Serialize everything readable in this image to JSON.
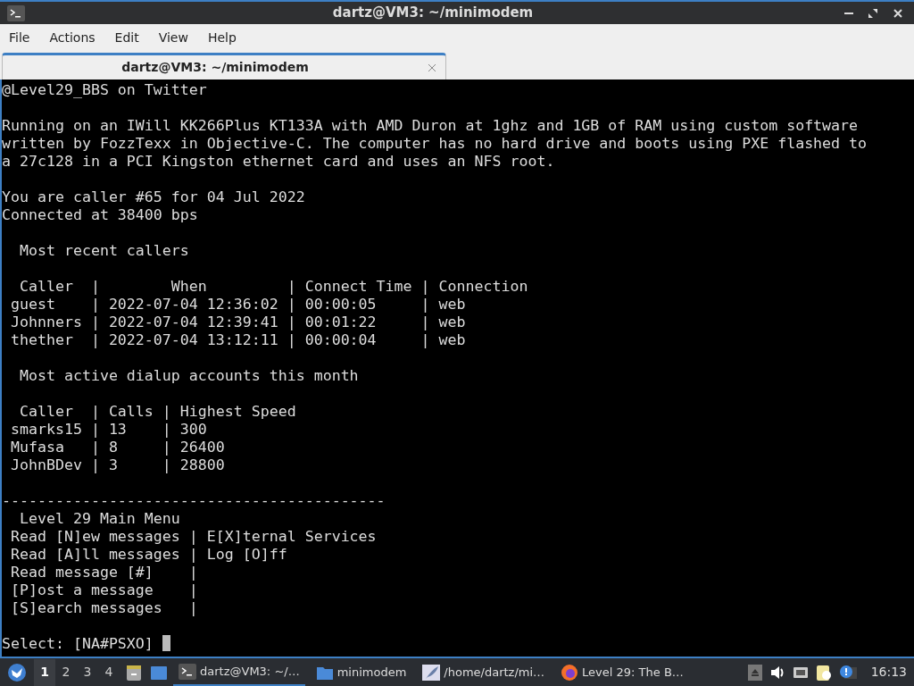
{
  "window": {
    "title": "dartz@VM3: ~/minimodem"
  },
  "menu": [
    "File",
    "Actions",
    "Edit",
    "View",
    "Help"
  ],
  "tabs": [
    {
      "label": "dartz@VM3: ~/minimodem",
      "selected": true
    }
  ],
  "terminal": {
    "blocks": [
      [
        "@Level29_BBS on Twitter"
      ],
      [
        "Running on an IWill KK266Plus KT133A with AMD Duron at 1ghz and 1GB of RAM using custom software",
        "written by FozzTexx in Objective-C. The computer has no hard drive and boots using PXE flashed to",
        "a 27c128 in a PCI Kingston ethernet card and uses an NFS root."
      ],
      [
        "You are caller #65 for 04 Jul 2022",
        "Connected at 38400 bps"
      ],
      [
        "  Most recent callers"
      ],
      [
        "  Caller  |        When         | Connect Time | Connection",
        " guest    | 2022-07-04 12:36:02 | 00:00:05     | web",
        " Johnners | 2022-07-04 12:39:41 | 00:01:22     | web",
        " thether  | 2022-07-04 13:12:11 | 00:00:04     | web"
      ],
      [
        "  Most active dialup accounts this month"
      ],
      [
        "  Caller  | Calls | Highest Speed",
        " smarks15 | 13    | 300",
        " Mufasa   | 8     | 26400",
        " JohnBDev | 3     | 28800"
      ],
      [
        "-------------------------------------------",
        "  Level 29 Main Menu",
        " Read [N]ew messages | E[X]ternal Services",
        " Read [A]ll messages | Log [O]ff",
        " Read message [#]    |",
        " [P]ost a message    |",
        " [S]earch messages   |"
      ]
    ],
    "prompt": "Select: [NA#PSXO]"
  },
  "taskbar": {
    "workspaces": [
      {
        "label": "1",
        "selected": true
      },
      {
        "label": "2",
        "selected": false
      },
      {
        "label": "3",
        "selected": false
      },
      {
        "label": "4",
        "selected": false
      }
    ],
    "tasks": [
      {
        "kind": "terminal",
        "label": "dartz@VM3: ~/…",
        "selected": true
      },
      {
        "kind": "folder",
        "label": "minimodem",
        "selected": false
      },
      {
        "kind": "editor",
        "label": "/home/dartz/mi…",
        "selected": false
      },
      {
        "kind": "browser",
        "label": "Level 29: The B…",
        "selected": false
      }
    ],
    "clock": "16:13"
  }
}
